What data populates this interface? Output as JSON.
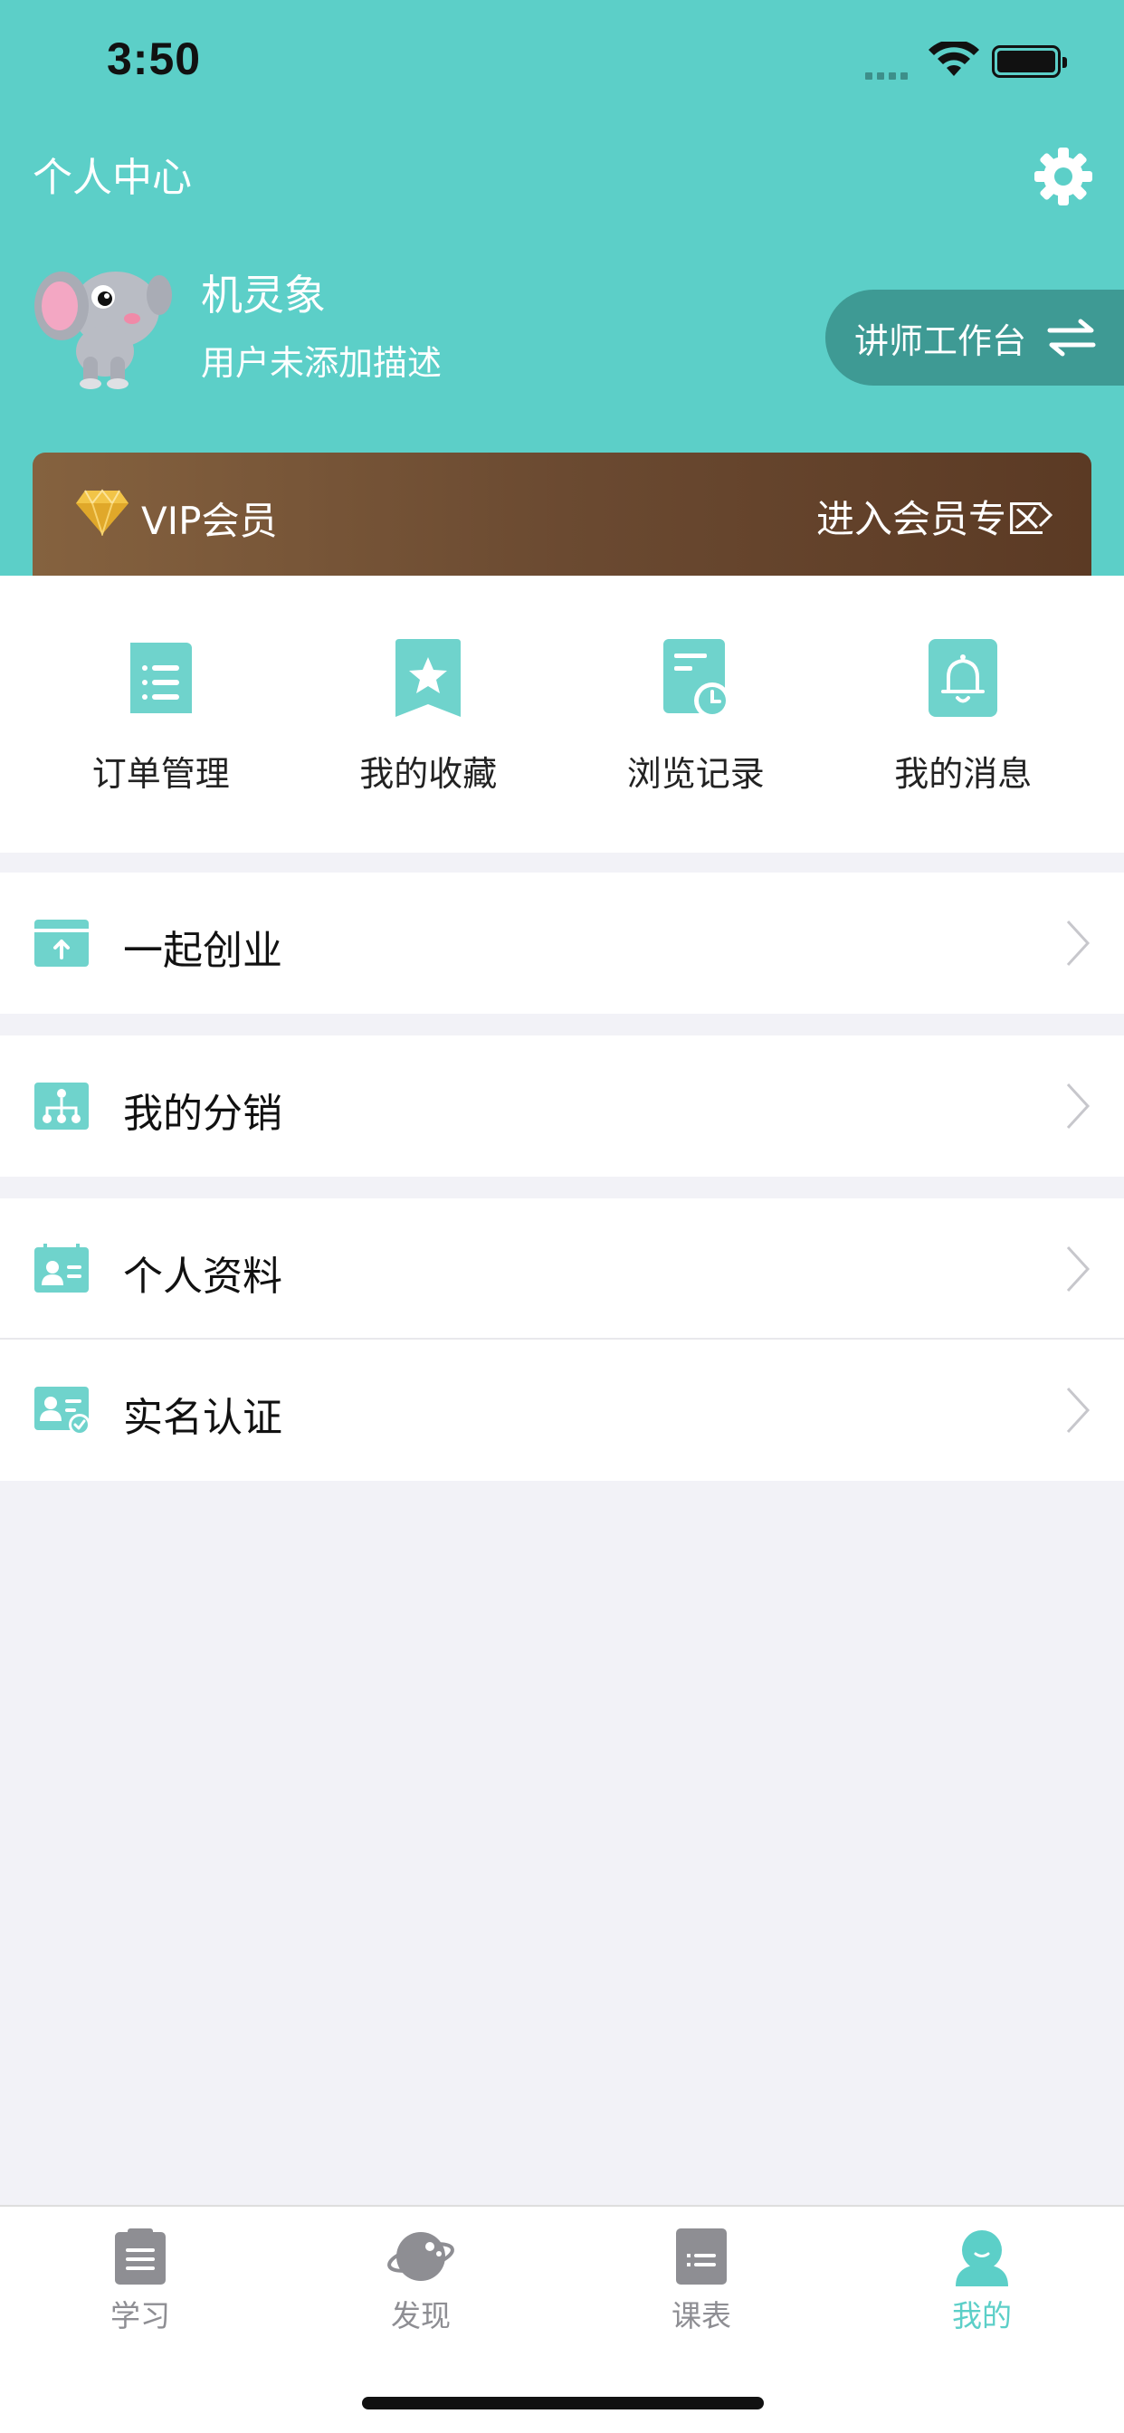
{
  "status": {
    "time": "3:50"
  },
  "header": {
    "title": "个人中心"
  },
  "user": {
    "name": "机灵象",
    "description": "用户未添加描述"
  },
  "teacher_button": {
    "label": "讲师工作台"
  },
  "vip": {
    "title": "VIP会员",
    "enter_label": "进入会员专区"
  },
  "quick_actions": [
    {
      "label": "订单管理",
      "icon": "order-list-icon"
    },
    {
      "label": "我的收藏",
      "icon": "favorite-star-icon"
    },
    {
      "label": "浏览记录",
      "icon": "history-clock-icon"
    },
    {
      "label": "我的消息",
      "icon": "bell-icon"
    }
  ],
  "menu": [
    {
      "label": "一起创业",
      "icon": "startup-box-icon"
    },
    {
      "label": "我的分销",
      "icon": "distribution-tree-icon"
    },
    {
      "label": "个人资料",
      "icon": "profile-card-icon"
    },
    {
      "label": "实名认证",
      "icon": "verified-id-icon"
    }
  ],
  "tabs": [
    {
      "label": "学习",
      "icon": "clipboard-icon",
      "active": false
    },
    {
      "label": "发现",
      "icon": "planet-icon",
      "active": false
    },
    {
      "label": "课表",
      "icon": "schedule-list-icon",
      "active": false
    },
    {
      "label": "我的",
      "icon": "person-icon",
      "active": true
    }
  ],
  "colors": {
    "accent": "#5ccfc8",
    "vip_start": "#85623f",
    "vip_end": "#5b3a24",
    "tab_inactive": "#8e8e93"
  }
}
